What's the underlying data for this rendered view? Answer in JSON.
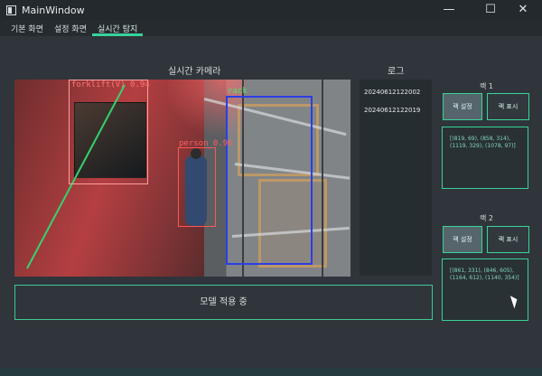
{
  "window": {
    "title": "MainWindow",
    "controls": {
      "minimize": "—",
      "maximize": "☐",
      "close": "✕"
    }
  },
  "tabs": [
    {
      "label": "기본 화면"
    },
    {
      "label": "설정 화면"
    },
    {
      "label": "실시간 탐지"
    }
  ],
  "camera": {
    "title": "실시간 카메라",
    "detections": {
      "forklift": "forklift(V) 0.94",
      "person": "person 0.96",
      "rack": "rack"
    }
  },
  "log": {
    "title": "로그",
    "items": [
      "20240612122002",
      "20240612122019"
    ]
  },
  "status": {
    "text": "모델 적용 중"
  },
  "rack1": {
    "title": "랙 1",
    "set": "랙 설정",
    "show": "랙 표시",
    "coords": "[(819, 69), (858, 314), (1119, 329), (1078, 97)]"
  },
  "rack2": {
    "title": "랙 2",
    "set": "랙 설정",
    "show": "랙 표시",
    "coords": "[(861, 331), (846, 605), (1164, 612), (1140, 354)]"
  },
  "icons": {
    "app": "window-icon",
    "cursor": "mouse-cursor-icon"
  }
}
